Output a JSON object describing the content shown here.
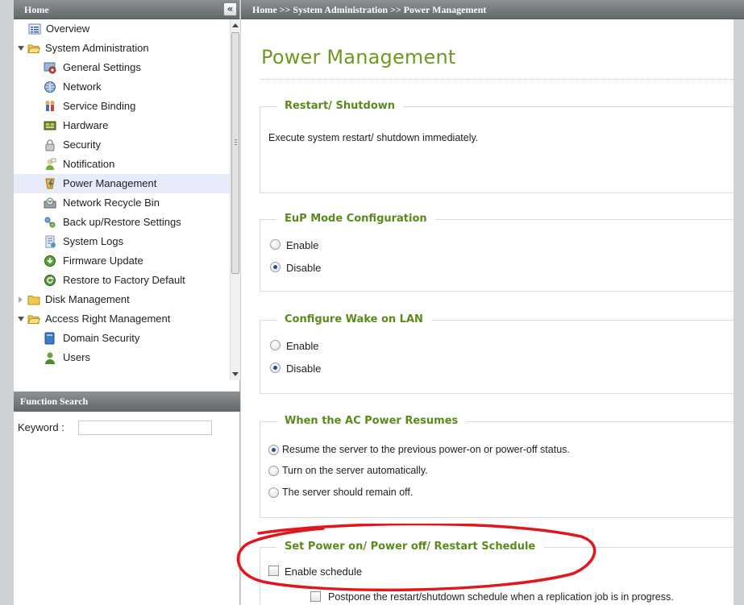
{
  "sidebar": {
    "header": "Home",
    "collapse_icon": "«",
    "tree": [
      {
        "label": "Overview",
        "icon": "overview-icon",
        "level": 1
      },
      {
        "label": "System Administration",
        "icon": "folder-open-icon",
        "level": 0,
        "expanded": true
      },
      {
        "label": "General Settings",
        "icon": "general-settings-icon",
        "level": 1
      },
      {
        "label": "Network",
        "icon": "network-icon",
        "level": 1
      },
      {
        "label": "Service Binding",
        "icon": "service-binding-icon",
        "level": 1
      },
      {
        "label": "Hardware",
        "icon": "hardware-icon",
        "level": 1
      },
      {
        "label": "Security",
        "icon": "lock-icon",
        "level": 1
      },
      {
        "label": "Notification",
        "icon": "notification-icon",
        "level": 1
      },
      {
        "label": "Power Management",
        "icon": "power-icon",
        "level": 1,
        "selected": true
      },
      {
        "label": "Network Recycle Bin",
        "icon": "recycle-bin-icon",
        "level": 1
      },
      {
        "label": "Back up/Restore Settings",
        "icon": "backup-icon",
        "level": 1
      },
      {
        "label": "System Logs",
        "icon": "logs-icon",
        "level": 1
      },
      {
        "label": "Firmware Update",
        "icon": "firmware-icon",
        "level": 1
      },
      {
        "label": "Restore to Factory Default",
        "icon": "factory-reset-icon",
        "level": 1
      },
      {
        "label": "Disk Management",
        "icon": "folder-icon",
        "level": 0,
        "expanded": false
      },
      {
        "label": "Access Right Management",
        "icon": "folder-open-icon",
        "level": 0,
        "expanded": true
      },
      {
        "label": "Domain Security",
        "icon": "domain-icon",
        "level": 1
      },
      {
        "label": "Users",
        "icon": "users-icon",
        "level": 1
      }
    ],
    "function_search": {
      "header": "Function Search",
      "keyword_label": "Keyword :",
      "keyword_value": ""
    }
  },
  "main": {
    "breadcrumb": "Home >> System Administration >> Power Management",
    "title": "Power Management",
    "restart": {
      "legend": "Restart/ Shutdown",
      "description": "Execute system restart/ shutdown immediately."
    },
    "eup": {
      "legend": "EuP Mode Configuration",
      "options": [
        "Enable",
        "Disable"
      ],
      "selected": "Disable"
    },
    "wol": {
      "legend": "Configure Wake on LAN",
      "options": [
        "Enable",
        "Disable"
      ],
      "selected": "Disable"
    },
    "ac_power": {
      "legend": "When the AC Power Resumes",
      "options": [
        "Resume the server to the previous power-on or power-off status.",
        "Turn on the server automatically.",
        "The server should remain off."
      ],
      "selected": "Resume the server to the previous power-on or power-off status."
    },
    "schedule": {
      "legend": "Set Power on/ Power off/ Restart Schedule",
      "enable_label": "Enable schedule",
      "enable_checked": false,
      "postpone_label": "Postpone the restart/shutdown schedule when a replication job is in progress.",
      "postpone_checked": false
    }
  },
  "colors": {
    "title_green": "#6b9b1f",
    "legend_green": "#5b8a1c",
    "header_gray": "#6e7275",
    "selection_bg": "#e7ebfa",
    "annotation_red": "#e0171c"
  }
}
